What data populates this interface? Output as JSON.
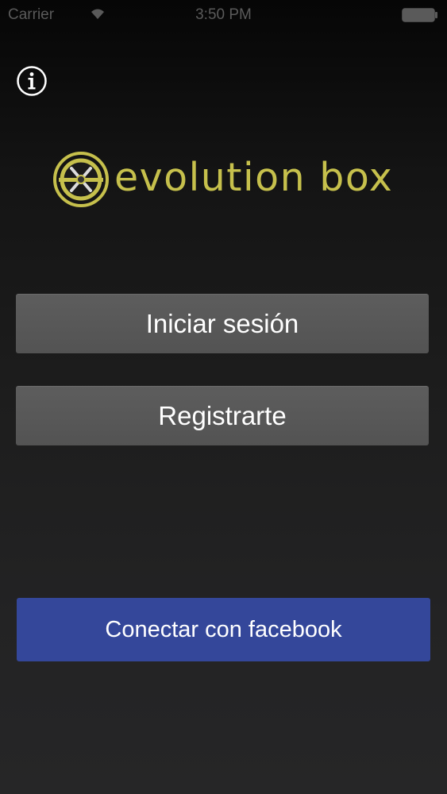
{
  "status_bar": {
    "carrier": "Carrier",
    "time": "3:50 PM",
    "wifi_icon": "wifi-icon",
    "battery_icon": "battery-icon"
  },
  "header": {
    "info_icon": "info-icon"
  },
  "logo": {
    "text": "evolution box",
    "mark_icon": "evolution-box-logo-mark",
    "color": "#c6c04c"
  },
  "actions": {
    "login_label": "Iniciar sesión",
    "register_label": "Registrarte",
    "facebook_label": "Conectar con facebook"
  },
  "colors": {
    "button_gray": "#575757",
    "facebook_blue": "#34479a",
    "logo_accent": "#c6c04c"
  }
}
